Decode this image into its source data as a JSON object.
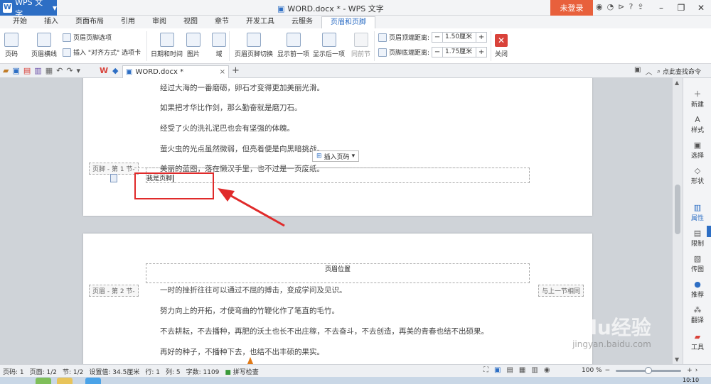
{
  "titlebar": {
    "app_name": "WPS 文字",
    "doc_title": "WORD.docx * - WPS 文字",
    "login": "未登录",
    "icons": [
      "skin-icon",
      "cloud-icon",
      "share-icon",
      "help-icon",
      "upload-icon"
    ]
  },
  "menu_tabs": [
    "开始",
    "插入",
    "页面布局",
    "引用",
    "审阅",
    "视图",
    "章节",
    "开发工具",
    "云服务",
    "页眉和页脚"
  ],
  "active_tab": "页眉和页脚",
  "ribbon": {
    "page_number": "页码",
    "header_line": "页眉横线",
    "header_footer_options": "页眉页脚选项",
    "insert_align_tab": "插入 \"对齐方式\" 选项卡",
    "date_time": "日期和时间",
    "picture": "图片",
    "field": "域",
    "switch_header_footer": "页眉页脚切换",
    "show_prev": "显示前一项",
    "show_next": "显示后一项",
    "same_as_prev": "同前节",
    "header_top_label": "页眉顶端距离:",
    "header_top_value": "1.50厘米",
    "footer_bottom_label": "页脚底端距离:",
    "footer_bottom_value": "1.75厘米",
    "close": "关闭"
  },
  "doc_tab": {
    "name": "WORD.docx *",
    "close": "×",
    "new_tab": "+",
    "search_command": "点此查找命令"
  },
  "page1": {
    "paragraphs": [
      "经过大海的一番磨砺，卵石才变得更加美丽光滑。",
      "如果把才华比作剑，那么勤奋就是磨刀石。",
      "经受了火的洗礼泥巴也会有坚强的体魄。",
      "萤火虫的光点虽然微弱，但亮着便是向黑暗挑战。",
      "美丽的蓝图，落在懒汉手里，也不过是一页废纸。"
    ],
    "footer_tag": "页脚 - 第 1 节-",
    "insert_page_number": "插入页码",
    "footer_text": "我是页脚"
  },
  "page2": {
    "header_tag": "页眉 - 第 2 节-",
    "header_position": "页眉位置",
    "same_as_prev_tag": "与上一节相同",
    "paragraphs": [
      "一时的挫折往往可以通过不屈的搏击，变成学问及见识。",
      "努力向上的开拓，才使弯曲的竹鞭化作了笔直的毛竹。",
      "不去耕耘，不去播种，再肥的沃土也长不出庄稼，不去奋斗，不去创造，再美的青春也结不出硕果。",
      "再好的种子，不播种下去，也结不出丰硕的果实。"
    ]
  },
  "right_panel": [
    {
      "icon": "plus-icon",
      "label": "新建"
    },
    {
      "icon": "style-icon",
      "label": "样式"
    },
    {
      "icon": "select-icon",
      "label": "选择"
    },
    {
      "icon": "shape-icon",
      "label": "形状"
    },
    {
      "icon": "properties-icon",
      "label": "属性"
    },
    {
      "icon": "restrict-icon",
      "label": "限制"
    },
    {
      "icon": "image-icon",
      "label": "传图"
    },
    {
      "icon": "recommend-icon",
      "label": "推荐"
    },
    {
      "icon": "translate-icon",
      "label": "翻译"
    },
    {
      "icon": "toolbox-icon",
      "label": "工具"
    }
  ],
  "active_panel": "属性",
  "statusbar": {
    "page": "页码: 1",
    "pages": "页面: 1/2",
    "section": "节: 1/2",
    "setting": "设置值: 34.5厘米",
    "row": "行: 1",
    "col": "列: 5",
    "words": "字数: 1109",
    "spellcheck": "拼写检查",
    "zoom": "100 %",
    "zoom_fraction": 0.5
  },
  "watermark": {
    "text": "Baidu经验",
    "url": "jingyan.baidu.com"
  },
  "taskbar": {
    "clock": "10:10"
  },
  "colors": {
    "accent": "#2d6ec4",
    "login": "#e8603c",
    "annotation": "#e02a2a",
    "close": "#d9423a"
  }
}
